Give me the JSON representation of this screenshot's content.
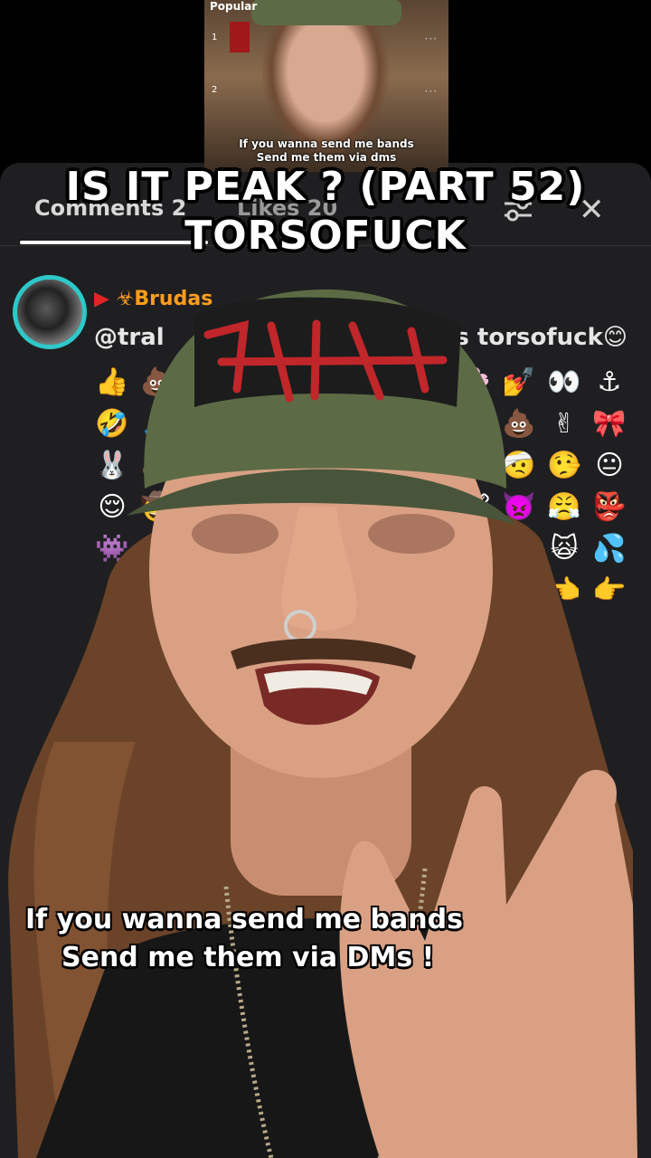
{
  "embed": {
    "section_label": "Popular",
    "ranks": [
      "1",
      "2"
    ],
    "caption_line1": "If you wanna send me bands",
    "caption_line2": "Send me them via dms"
  },
  "panel": {
    "tab_comments": "Comments 2",
    "tab_likes": "Likes 20",
    "comment": {
      "author_flag": "▶",
      "author_name": "☣Brudas",
      "mention": "@tral",
      "text_tail": "es torsofuck😊",
      "emoji_rows": [
        [
          "👍",
          "💩",
          "",
          "",
          "",
          "",
          "",
          "",
          "🌸",
          "💅",
          "👀",
          "⚓"
        ],
        [
          "🤣",
          "🙏",
          "",
          "",
          "",
          "",
          "",
          "",
          "🔫",
          "💩",
          "✌",
          "🎀"
        ],
        [
          "🐰",
          "💩",
          "",
          "",
          "",
          "",
          "",
          "",
          "🤯",
          "🤕",
          "🤥",
          "😐"
        ],
        [
          "😌",
          "🤠",
          "",
          "",
          "",
          "",
          "",
          "",
          "🐮",
          "👿",
          "😤",
          "👺"
        ],
        [
          "👾",
          "",
          "",
          "",
          "",
          "",
          "",
          "",
          "",
          "👺",
          "🙀",
          "💦"
        ],
        [
          "",
          "",
          "",
          "",
          "",
          "",
          "",
          "",
          "",
          "👉",
          "👈",
          "👉"
        ]
      ]
    }
  },
  "overlay": {
    "title_line1": "IS IT PEAK ? (PART 52)",
    "title_line2": "TORSOFUCK",
    "caption_line1": "If you wanna send me bands",
    "caption_line2": "Send me them via DMs !"
  },
  "colors": {
    "panel_bg": "#1f1f21",
    "avatar_ring": "#2ec8c8",
    "author_accent": "#ff9d1e",
    "hat_green": "#5c6b45",
    "hat_patch_red": "#c0262a"
  }
}
